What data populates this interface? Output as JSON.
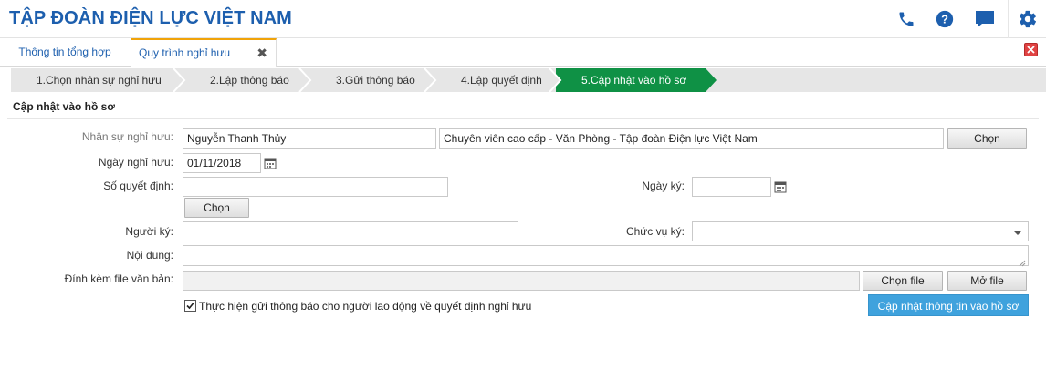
{
  "header": {
    "brand": "TẬP ĐOÀN ĐIỆN LỰC VIỆT NAM",
    "icons": [
      "phone-icon",
      "help-icon",
      "chat-icon",
      "gear-icon"
    ],
    "brand_color": "#1d5fae"
  },
  "tabs": [
    {
      "label": "Thông tin tổng hợp"
    },
    {
      "label": "Quy trình nghỉ hưu",
      "active": true
    }
  ],
  "steps": [
    {
      "label": "1.Chọn nhân sự nghỉ hưu"
    },
    {
      "label": "2.Lập thông báo"
    },
    {
      "label": "3.Gửi thông báo"
    },
    {
      "label": "4.Lập quyết định"
    },
    {
      "label": "5.Cập nhật vào hồ sơ",
      "active": true
    }
  ],
  "step_active_color": "#0f9145",
  "form": {
    "section_title": "Cập nhật vào hồ sơ",
    "nhan_su": {
      "label": "Nhân sự nghỉ hưu:",
      "name": "Nguyễn Thanh Thủy",
      "position": "Chuyên viên cao cấp - Văn Phòng - Tập đoàn Điện lực Việt Nam",
      "button": "Chọn"
    },
    "ngay_nghi_huu": {
      "label": "Ngày nghỉ hưu:",
      "value": "01/11/2018"
    },
    "so_quyet_dinh": {
      "label": "Số quyết định:",
      "value": "",
      "button": "Chọn"
    },
    "ngay_ky": {
      "label": "Ngày ký:",
      "value": ""
    },
    "nguoi_ky": {
      "label": "Người ký:",
      "value": ""
    },
    "chuc_vu_ky": {
      "label": "Chức vụ ký:",
      "value": ""
    },
    "noi_dung": {
      "label": "Nội dung:",
      "value": ""
    },
    "dinh_kem": {
      "label": "Đính kèm file văn bản:",
      "value": "",
      "choose_button": "Chọn file",
      "open_button": "Mở file"
    },
    "notify_checkbox": {
      "label": "Thực hiện gửi thông báo cho người lao động về quyết định nghỉ hưu",
      "checked": true
    },
    "submit_button": "Cập nhật thông tin vào hồ sơ",
    "submit_color": "#3fa2dd"
  }
}
